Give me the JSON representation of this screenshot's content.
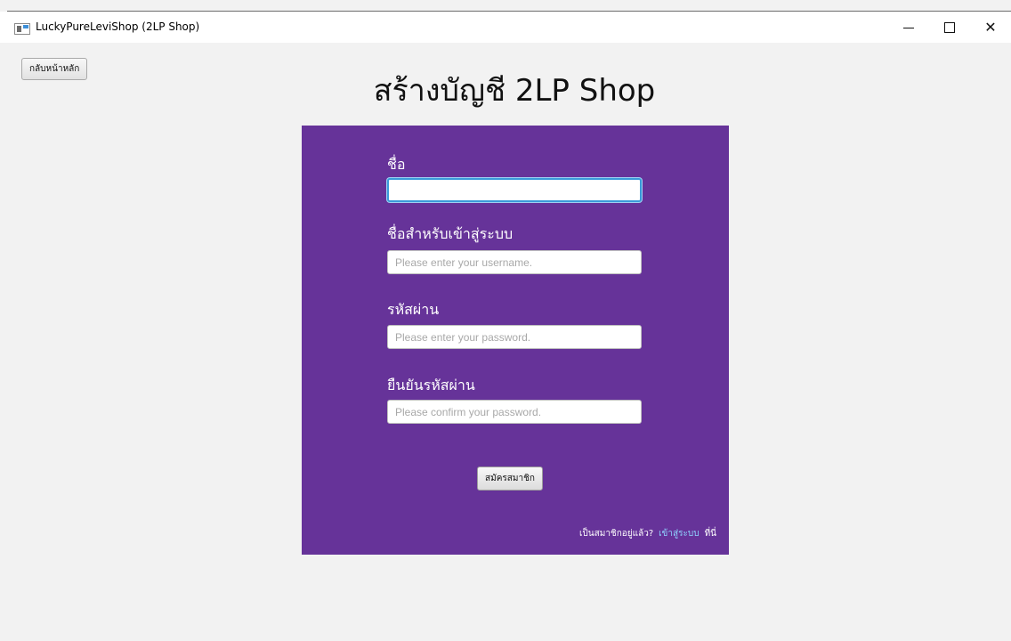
{
  "window": {
    "title": "LuckyPureLeviShop (2LP Shop)",
    "icon": "app-window-icon",
    "controls": {
      "minimize": "minimize-icon",
      "maximize": "maximize-icon",
      "close": "✕"
    }
  },
  "header": {
    "back_label": "กลับหน้าหลัก",
    "page_title": "สร้างบัญชี 2LP Shop"
  },
  "form": {
    "background": "#663399",
    "fields": [
      {
        "label": "ชื่อ",
        "value": "",
        "placeholder": "",
        "focused": true
      },
      {
        "label": "ชื่อสำหรับเข้าสู่ระบบ",
        "value": "",
        "placeholder": "Please enter your username."
      },
      {
        "label": "รหัสผ่าน",
        "value": "",
        "placeholder": "Please enter your password."
      },
      {
        "label": "ยืนยันรหัสผ่าน",
        "value": "",
        "placeholder": "Please confirm your password."
      }
    ],
    "submit_label": "สมัครสมาชิก",
    "footer": {
      "prefix": "เป็นสมาชิกอยู่แล้ว?",
      "link": "เข้าสู่ระบบ",
      "suffix": "ที่นี่",
      "link_color": "#8fd3ff"
    }
  }
}
